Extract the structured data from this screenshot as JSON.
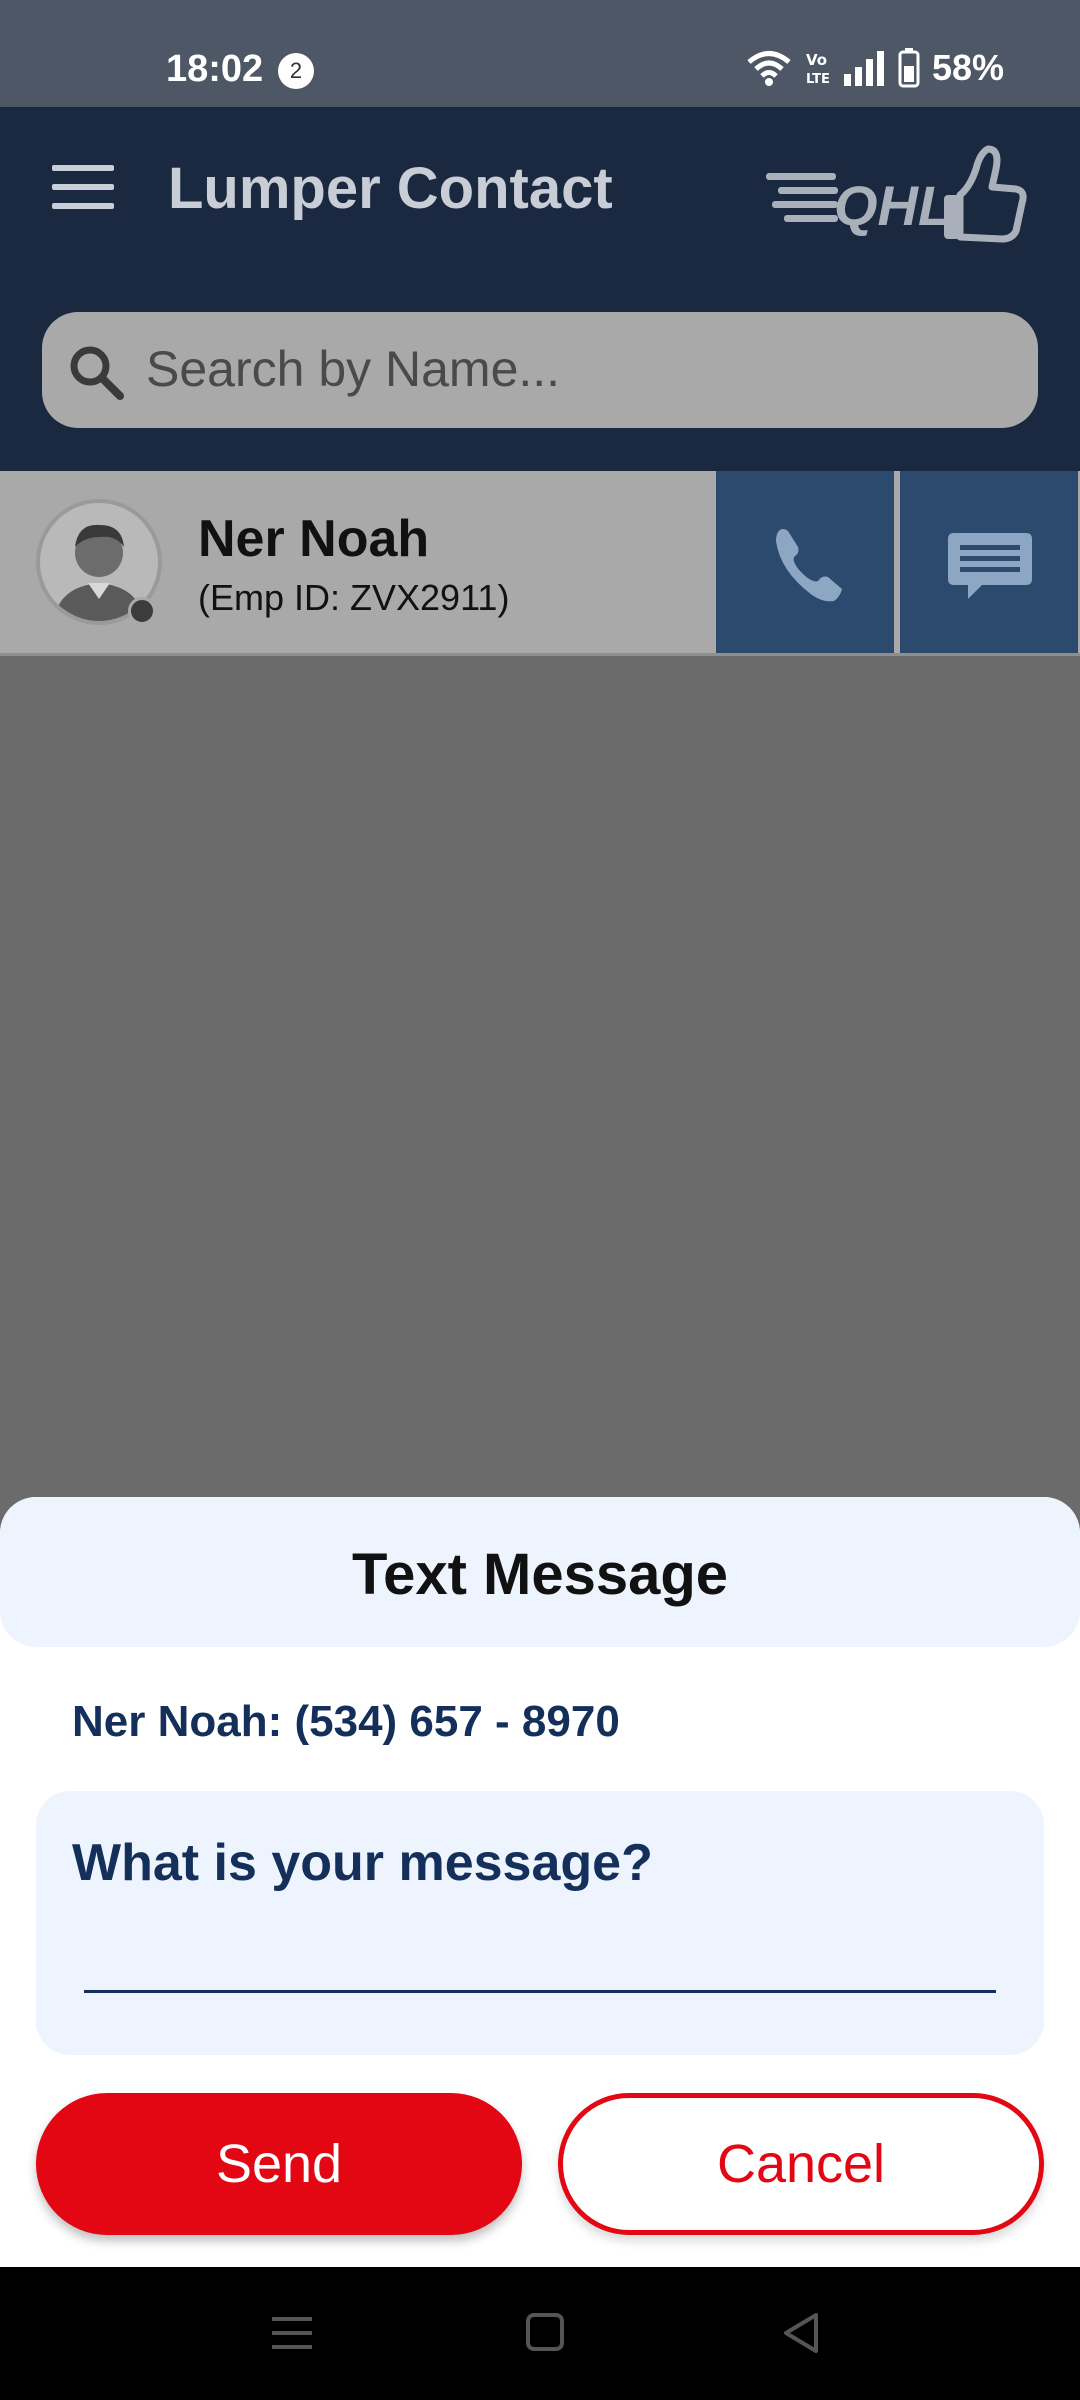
{
  "status_bar": {
    "time": "18:02",
    "notification_count": "2",
    "battery": "58%"
  },
  "header": {
    "title": "Lumper Contact",
    "logo_text": "QHL"
  },
  "search": {
    "placeholder": "Search by Name..."
  },
  "contacts": [
    {
      "name": "Ner Noah",
      "emp_id": "(Emp ID: ZVX2911)"
    }
  ],
  "dialog": {
    "title": "Text Message",
    "recipient": "Ner Noah: (534) 657 - 8970",
    "message_label": "What is your message?",
    "message_value": "",
    "send_label": "Send",
    "cancel_label": "Cancel"
  },
  "colors": {
    "header_bg": "#1a2840",
    "accent_red": "#e30613",
    "action_blue": "#2b4a6e",
    "text_navy": "#14305a",
    "sheet_tint": "#eef4fe"
  },
  "icons": [
    "menu-icon",
    "search-icon",
    "phone-icon",
    "message-icon",
    "wifi-icon",
    "volte-icon",
    "signal-icon",
    "battery-icon",
    "nav-menu-icon",
    "nav-home-icon",
    "nav-back-icon"
  ]
}
